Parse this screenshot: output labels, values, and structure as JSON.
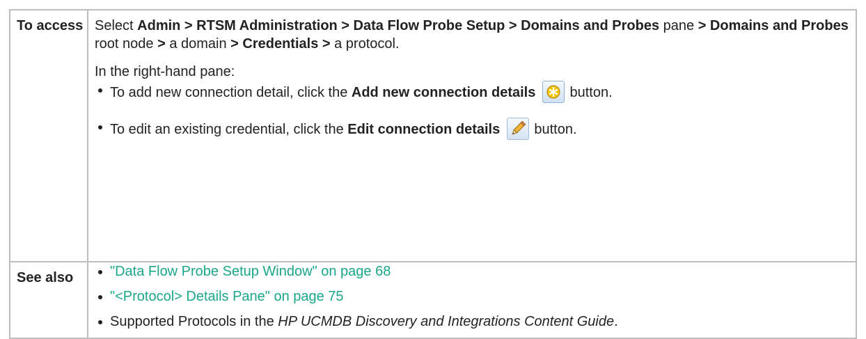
{
  "access": {
    "label": "To access",
    "intro": {
      "t1": "Select ",
      "b1": "Admin > RTSM Administration > Data Flow Probe Setup > Domains and Probes",
      "t2": " pane ",
      "b2": "> Domains and Probes",
      "t3": " root node ",
      "b3": ">",
      "t4": " a domain ",
      "b4": "> Credentials >",
      "t5": " a protocol."
    },
    "right_pane": "In the right-hand pane:",
    "bullets": [
      {
        "pre": "To add new connection detail, click the ",
        "bold": "Add new connection details",
        "icon": "add-connection-icon",
        "post": " button."
      },
      {
        "pre": "To edit an existing credential, click the ",
        "bold": "Edit connection details",
        "icon": "edit-pencil-icon",
        "post": " button."
      }
    ]
  },
  "see_also": {
    "label": "See also",
    "links": [
      "\"Data Flow Probe Setup Window\" on page 68",
      "\"<Protocol> Details Pane\" on page 75"
    ],
    "last": {
      "pre": "Supported Protocols in the ",
      "italic": "HP UCMDB Discovery and Integrations Content Guide",
      "post": "."
    }
  },
  "colors": {
    "text": "#222222",
    "link": "#1aa68a",
    "border": "#bdbdbd"
  }
}
